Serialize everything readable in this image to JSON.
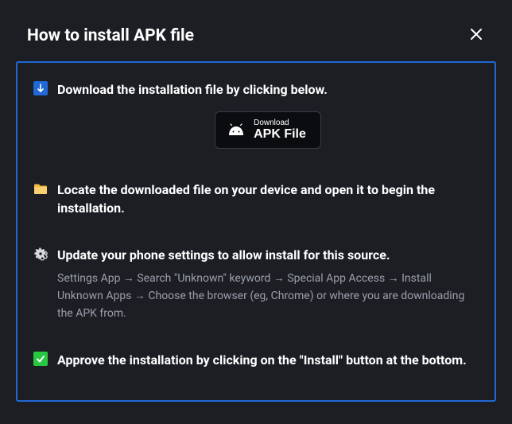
{
  "modal": {
    "title": "How to install APK file"
  },
  "steps": {
    "s1": {
      "text": "Download the installation file by clicking below."
    },
    "s2": {
      "text": "Locate the downloaded file on your device and open it to begin the installation."
    },
    "s3": {
      "text": "Update your phone settings to allow install for this source.",
      "sub": "Settings App → Search \"Unknown\" keyword → Special App Access → Install Unknown Apps → Choose the browser (eg, Chrome) or where you are downloading the APK from."
    },
    "s4": {
      "text": "Approve the installation by clicking on the \"Install\" button at the bottom."
    }
  },
  "download_button": {
    "small": "Download",
    "big": "APK File"
  }
}
